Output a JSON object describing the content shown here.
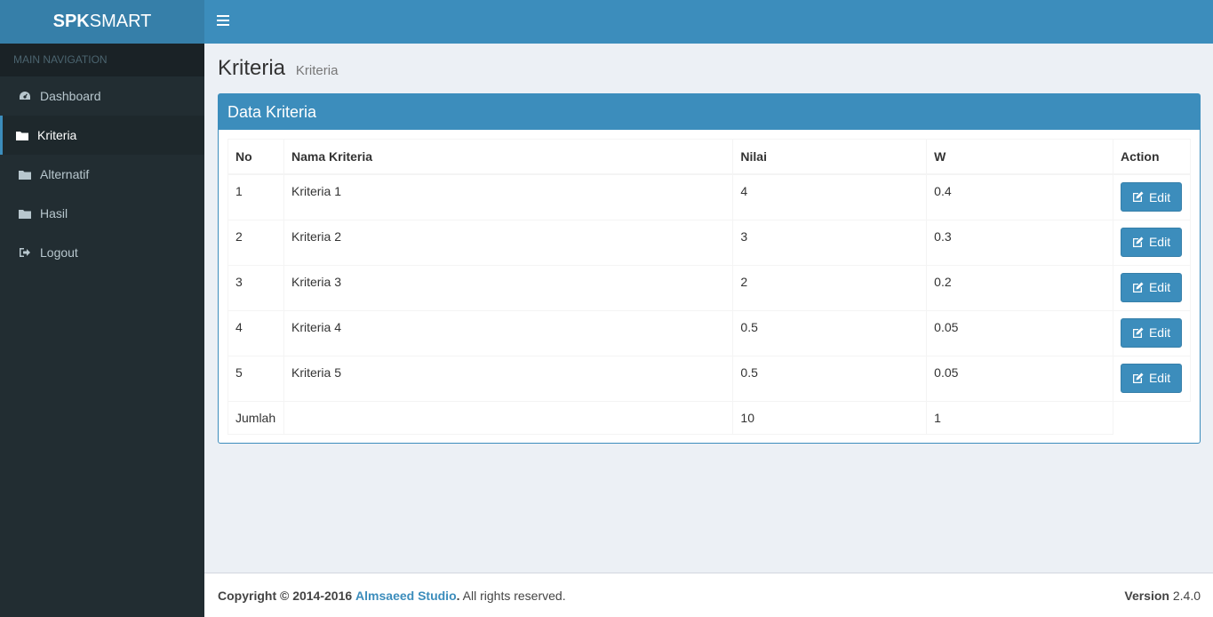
{
  "brand": {
    "bold": "SPK",
    "light": "SMART"
  },
  "sidebar": {
    "header": "MAIN NAVIGATION",
    "items": [
      {
        "label": "Dashboard",
        "icon": "dashboard-icon"
      },
      {
        "label": "Kriteria",
        "icon": "folder-icon",
        "active": true
      },
      {
        "label": "Alternatif",
        "icon": "folder-icon"
      },
      {
        "label": "Hasil",
        "icon": "folder-icon"
      },
      {
        "label": "Logout",
        "icon": "sign-out-icon"
      }
    ]
  },
  "page": {
    "title": "Kriteria",
    "subtitle": "Kriteria"
  },
  "box": {
    "title": "Data Kriteria"
  },
  "table": {
    "headers": [
      "No",
      "Nama Kriteria",
      "Nilai",
      "W",
      "Action"
    ],
    "rows": [
      {
        "no": "1",
        "name": "Kriteria 1",
        "nilai": "4",
        "w": "0.4"
      },
      {
        "no": "2",
        "name": "Kriteria 2",
        "nilai": "3",
        "w": "0.3"
      },
      {
        "no": "3",
        "name": "Kriteria 3",
        "nilai": "2",
        "w": "0.2"
      },
      {
        "no": "4",
        "name": "Kriteria 4",
        "nilai": "0.5",
        "w": "0.05"
      },
      {
        "no": "5",
        "name": "Kriteria 5",
        "nilai": "0.5",
        "w": "0.05"
      }
    ],
    "edit_label": "Edit",
    "total": {
      "label": "Jumlah",
      "nilai": "10",
      "w": "1"
    }
  },
  "footer": {
    "copyright": "Copyright © 2014-2016",
    "company": "Almsaeed Studio",
    "rights": ". All rights reserved.",
    "version_label": "Version",
    "version": "2.4.0"
  },
  "colors": {
    "primary": "#3c8dbc",
    "sidebar": "#222d32",
    "logo": "#367fa9"
  }
}
